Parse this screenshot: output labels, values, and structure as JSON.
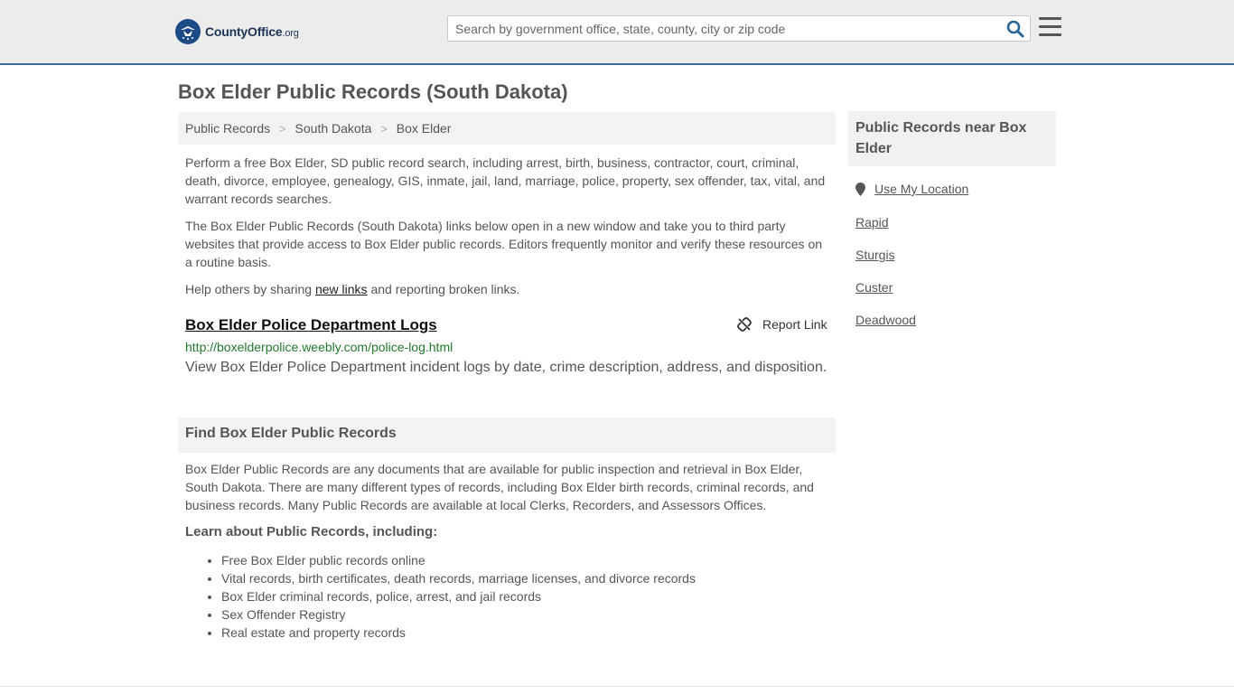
{
  "header": {
    "logo": {
      "brand": "CountyOffice",
      "tld": ".org"
    },
    "search_placeholder": "Search by government office, state, county, city or zip code",
    "search_icon": "magnifier-icon",
    "menu_icon": "hamburger-menu-icon"
  },
  "page_title": "Box Elder Public Records (South Dakota)",
  "breadcrumb": [
    "Public Records",
    "South Dakota",
    "Box Elder"
  ],
  "intro": {
    "p1": "Perform a free Box Elder, SD public record search, including arrest, birth, business, contractor, court, criminal, death, divorce, employee, genealogy, GIS, inmate, jail, land, marriage, police, property, sex offender, tax, vital, and warrant records searches.",
    "p2": "The Box Elder Public Records (South Dakota) links below open in a new window and take you to third party websites that provide access to Box Elder public records. Editors frequently monitor and verify these resources on a routine basis.",
    "p3_before": "Help others by sharing ",
    "p3_link": "new links",
    "p3_after": " and reporting broken links."
  },
  "listing": {
    "title": "Box Elder Police Department Logs",
    "report_label": "Report Link",
    "report_icon": "broken-link-icon",
    "url": "http://boxelderpolice.weebly.com/police-log.html",
    "description": "View Box Elder Police Department incident logs by date, crime description, address, and disposition."
  },
  "find_section": {
    "heading": "Find Box Elder Public Records",
    "body": "Box Elder Public Records are any documents that are available for public inspection and retrieval in Box Elder, South Dakota. There are many different types of records, including Box Elder birth records, criminal records, and business records. Many Public Records are available at local Clerks, Recorders, and Assessors Offices.",
    "subheading": "Learn about Public Records, including:",
    "items": [
      "Free Box Elder public records online",
      "Vital records, birth certificates, death records, marriage licenses, and divorce records",
      "Box Elder criminal records, police, arrest, and jail records",
      "Sex Offender Registry",
      "Real estate and property records"
    ]
  },
  "sidebar": {
    "heading": "Public Records near Box Elder",
    "use_location": "Use My Location",
    "location_icon": "map-pin-icon",
    "nearby": [
      "Rapid",
      "Sturgis",
      "Custer",
      "Deadwood"
    ]
  }
}
